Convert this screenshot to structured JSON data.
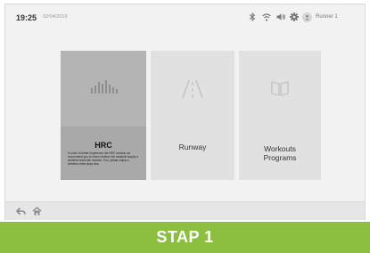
{
  "status": {
    "time": "19:25",
    "date": "02/04/2019",
    "user": "Runner 1",
    "icons": [
      "bluetooth-icon",
      "wifi-icon",
      "volume-icon",
      "settings-gear-icon",
      "user-icon"
    ]
  },
  "tiles": [
    {
      "title": "HRC",
      "icon": "heart-rate-bars-icon",
      "selected": true,
      "description": "In order to better experience the HRC function we recommend you to check whether the treadmill supply a wireless heart rate receiver. If so, please equip a wireless chest strap also."
    },
    {
      "title": "Runway",
      "icon": "road-icon",
      "selected": false
    },
    {
      "title_line1": "Workouts",
      "title_line2": "Programs",
      "icon": "open-book-icon",
      "selected": false
    }
  ],
  "nav": {
    "icons": [
      "back-arrow-icon",
      "home-icon"
    ]
  },
  "banner": {
    "label": "STAP 1",
    "color": "#8cbe3f"
  }
}
